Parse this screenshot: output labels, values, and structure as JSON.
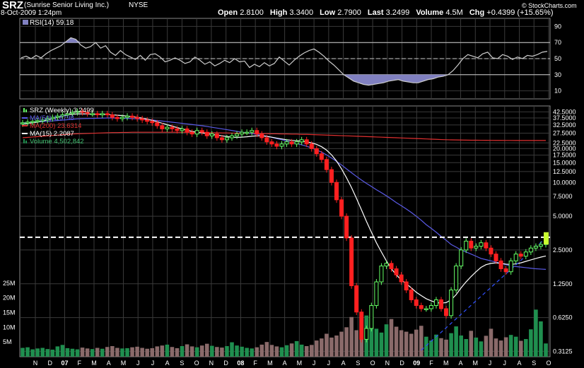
{
  "header": {
    "symbol": "SRZ",
    "company": "(Sunrise Senior Living Inc.)",
    "exchange": "NYSE",
    "datetime": "8-Oct-2009 1:24pm",
    "brand": "© StockCharts.com",
    "quote": {
      "open_label": "Open",
      "open": "2.8100",
      "high_label": "High",
      "high": "3.3400",
      "low_label": "Low",
      "low": "2.7900",
      "last_label": "Last",
      "last": "3.2499",
      "volume_label": "Volume",
      "volume": "4.5M",
      "chg_label": "Chg",
      "chg": "+0.4399 (+15.65%)"
    }
  },
  "colors": {
    "background": "#000000",
    "grid": "#3a3a3a",
    "up_candle": "#66ff66",
    "down_candle": "#ff2020",
    "ma50": "#5a5ae6",
    "ma200": "#e03030",
    "ma15": "#ffffff",
    "rsi_line": "#cccccc",
    "rsi_fill": "#8080c0",
    "volume_up": "#1f8f4f",
    "volume_down": "#8a6a6a",
    "resistance": "#ffffff",
    "trendline": "#3050ff"
  },
  "chart_data": [
    {
      "type": "line",
      "title": "RSI(14) 59.18",
      "legend": [
        {
          "name": "RSI(14)",
          "value": "59.18"
        }
      ],
      "yticks": [
        "90",
        "70",
        "50",
        "30",
        "10"
      ],
      "ylim": [
        0,
        100
      ],
      "reference_lines": [
        70,
        50,
        30
      ],
      "series": [
        {
          "name": "RSI(14)",
          "values": [
            51,
            53,
            50,
            54,
            51,
            56,
            60,
            63,
            66,
            71,
            76,
            74,
            67,
            63,
            65,
            70,
            63,
            66,
            58,
            54,
            60,
            55,
            52,
            49,
            54,
            48,
            55,
            56,
            52,
            46,
            48,
            51,
            48,
            44,
            46,
            52,
            48,
            43,
            46,
            41,
            44,
            48,
            45,
            50,
            46,
            47,
            39,
            43,
            40,
            45,
            41,
            44,
            52,
            47,
            42,
            48,
            53,
            57,
            60,
            62,
            58,
            53,
            47,
            42,
            36,
            30,
            26,
            22,
            20,
            18,
            17,
            18,
            19,
            20,
            22,
            23,
            24,
            22,
            21,
            20,
            20,
            22,
            24,
            25,
            27,
            28,
            30,
            35,
            42,
            50,
            55,
            53,
            51,
            56,
            58,
            51,
            50,
            55,
            53,
            49,
            52,
            50,
            54,
            53,
            55,
            58,
            59
          ]
        }
      ]
    },
    {
      "type": "line",
      "title": "SRZ (Weekly) 3.2499",
      "legend": [
        {
          "name": "SRZ (Weekly)",
          "value": "3.2499"
        },
        {
          "name": "MA(50)",
          "value": "1.6798"
        },
        {
          "name": "MA(200)",
          "value": "23.6314"
        },
        {
          "name": "MA(15)",
          "value": "2.2087"
        },
        {
          "name": "Volume",
          "value": "4,502,842"
        }
      ],
      "yscale": "log",
      "ylim": [
        0.28,
        48
      ],
      "yticks": [
        "42.5000",
        "37.5000",
        "32.5000",
        "27.5000",
        "22.5000",
        "20.0000",
        "17.5000",
        "15.0000",
        "12.5000",
        "10.0000",
        "7.5000",
        "5.0000",
        "2.5000",
        "1.2500",
        "0.6250",
        "0.3125"
      ],
      "ytick_values": [
        42.5,
        37.5,
        32.5,
        27.5,
        22.5,
        20,
        17.5,
        15,
        12.5,
        10,
        7.5,
        5,
        2.5,
        1.25,
        0.625,
        0.3125
      ],
      "xticks": [
        "N",
        "D",
        "07",
        "F",
        "M",
        "A",
        "M",
        "J",
        "J",
        "A",
        "S",
        "O",
        "N",
        "D",
        "08",
        "F",
        "M",
        "A",
        "M",
        "J",
        "J",
        "A",
        "S",
        "O",
        "N",
        "D",
        "09",
        "F",
        "M",
        "A",
        "M",
        "J",
        "J",
        "A",
        "S",
        "O"
      ],
      "resistance_level": 3.25,
      "series": [
        {
          "name": "SRZ (Weekly)",
          "values": [
            34,
            34.5,
            35,
            35.5,
            36,
            37,
            38,
            39,
            40,
            41,
            42,
            43,
            42,
            41,
            41,
            40,
            41,
            40,
            38,
            37,
            38,
            39,
            38,
            37,
            36,
            35,
            34,
            32,
            30,
            31,
            30,
            29,
            30,
            28,
            27,
            29,
            28,
            26,
            27,
            25,
            24,
            25,
            26,
            27,
            28,
            28,
            29,
            27,
            25,
            23,
            22,
            21,
            22,
            23,
            22,
            23,
            24,
            22,
            20,
            18,
            16,
            13,
            10,
            7,
            5,
            3.2,
            1.2,
            0.7,
            0.4,
            0.5,
            0.8,
            1.3,
            1.8,
            1.9,
            1.7,
            1.5,
            1.3,
            1.1,
            0.9,
            0.8,
            0.75,
            0.75,
            0.8,
            0.9,
            0.75,
            0.65,
            1.1,
            1.8,
            2.5,
            3,
            2.6,
            2.7,
            2.9,
            2.6,
            2.3,
            2,
            1.7,
            1.6,
            2,
            2.3,
            2.2,
            2.4,
            2.6,
            2.7,
            2.8,
            3.2
          ]
        },
        {
          "name": "MA(50)",
          "values": [
            34,
            34.2,
            34.4,
            34.6,
            34.8,
            35,
            35.3,
            35.6,
            35.9,
            36.2,
            36.5,
            36.8,
            37,
            37.1,
            37.2,
            37.3,
            37.4,
            37.5,
            37.5,
            37.4,
            37.3,
            37.2,
            37,
            36.8,
            36.6,
            36.3,
            36,
            35.6,
            35.2,
            34.8,
            34.4,
            34,
            33.6,
            33.2,
            32.8,
            32.4,
            32,
            31.5,
            31,
            30.5,
            30,
            29.5,
            29,
            28.5,
            28,
            27.6,
            27.2,
            26.8,
            26.3,
            25.8,
            25.2,
            24.6,
            24,
            23.4,
            22.8,
            22.2,
            21.6,
            21,
            20.3,
            19.5,
            18.6,
            17.6,
            16.5,
            15.4,
            14.3,
            13.2,
            12.2,
            11.3,
            10.5,
            9.8,
            9.2,
            8.6,
            8.1,
            7.6,
            7.1,
            6.6,
            6.2,
            5.8,
            5.4,
            5,
            4.6,
            4.2,
            3.9,
            3.6,
            3.3,
            3.05,
            2.8,
            2.65,
            2.5,
            2.4,
            2.3,
            2.2,
            2.1,
            2.05,
            2,
            1.95,
            1.9,
            1.85,
            1.8,
            1.78,
            1.76,
            1.74,
            1.72,
            1.7,
            1.69,
            1.68
          ]
        },
        {
          "name": "MA(200)",
          "values": [
            25,
            25.2,
            25.4,
            25.6,
            25.8,
            26,
            26.2,
            26.4,
            26.6,
            26.8,
            27,
            27.1,
            27.2,
            27.3,
            27.4,
            27.5,
            27.6,
            27.7,
            27.8,
            27.8,
            27.9,
            27.9,
            28,
            28,
            28,
            28,
            28,
            28,
            28,
            28,
            28,
            28,
            28,
            28,
            27.9,
            27.9,
            27.8,
            27.8,
            27.7,
            27.7,
            27.6,
            27.6,
            27.5,
            27.5,
            27.4,
            27.4,
            27.3,
            27.3,
            27.2,
            27.2,
            27.1,
            27.1,
            27,
            27,
            26.9,
            26.9,
            26.8,
            26.8,
            26.7,
            26.6,
            26.5,
            26.4,
            26.3,
            26.2,
            26.1,
            26,
            25.9,
            25.8,
            25.7,
            25.6,
            25.5,
            25.4,
            25.3,
            25.2,
            25.1,
            25,
            24.9,
            24.8,
            24.7,
            24.6,
            24.5,
            24.4,
            24.3,
            24.2,
            24.1,
            24,
            23.95,
            23.9,
            23.85,
            23.8,
            23.78,
            23.76,
            23.74,
            23.72,
            23.7,
            23.69,
            23.68,
            23.67,
            23.66,
            23.65,
            23.645,
            23.64,
            23.638,
            23.636,
            23.634,
            23.6314
          ]
        },
        {
          "name": "MA(15)",
          "values": [
            33,
            33.5,
            34,
            34.5,
            35.2,
            36,
            37,
            38,
            39,
            40,
            40.5,
            40.8,
            40.8,
            40.7,
            40.6,
            40.5,
            40.4,
            40.2,
            40,
            39.7,
            39.4,
            39,
            38.6,
            38,
            37.4,
            36.6,
            35.7,
            34.7,
            33.7,
            32.7,
            31.7,
            30.8,
            30,
            29.2,
            28.5,
            28,
            27.6,
            27.2,
            26.8,
            26.4,
            26,
            25.6,
            25.3,
            25.2,
            25.3,
            25.5,
            25.8,
            26,
            26,
            25.7,
            25.3,
            24.8,
            24.4,
            24,
            23.7,
            23.5,
            23.3,
            23,
            22.5,
            21.8,
            20.8,
            19.4,
            17.6,
            15.5,
            13.2,
            11,
            9,
            7.2,
            5.7,
            4.5,
            3.6,
            2.9,
            2.4,
            2,
            1.7,
            1.5,
            1.35,
            1.25,
            1.15,
            1.05,
            0.98,
            0.92,
            0.88,
            0.85,
            0.84,
            0.85,
            0.9,
            1,
            1.15,
            1.3,
            1.45,
            1.6,
            1.75,
            1.85,
            1.9,
            1.92,
            1.9,
            1.87,
            1.86,
            1.88,
            1.92,
            1.98,
            2.04,
            2.1,
            2.16,
            2.2087
          ]
        },
        {
          "name": "Volume",
          "values": [
            3,
            3.2,
            2.5,
            2.8,
            3,
            2.6,
            2.4,
            3.5,
            4,
            2.9,
            2.7,
            2.5,
            3.1,
            2.8,
            2.6,
            3,
            2.7,
            3.3,
            3.6,
            3,
            2.8,
            2.9,
            3.2,
            3.4,
            3,
            2.7,
            2.9,
            3.5,
            3.8,
            4.1,
            3.3,
            2.9,
            3.6,
            4.2,
            3.5,
            3.2,
            3.8,
            4.4,
            3.7,
            3.3,
            3.1,
            3.6,
            4.9,
            3.8,
            3.4,
            3,
            2.8,
            3.2,
            4.1,
            5,
            4,
            3.5,
            3.2,
            3.9,
            4.5,
            5.3,
            4.1,
            3.6,
            4,
            5.5,
            6.2,
            7.8,
            6.5,
            7.2,
            8.5,
            10,
            13.5,
            9,
            11,
            14,
            12.5,
            9.5,
            8.2,
            11,
            12.8,
            10.2,
            9,
            8.5,
            7.8,
            9.2,
            10.5,
            6.8,
            5.5,
            7.5,
            6.3,
            5.8,
            8,
            10.3,
            7.2,
            6,
            8.8,
            6.5,
            5.2,
            7.1,
            9.5,
            6.2,
            5.5,
            6.6,
            7.4,
            6.8,
            5.4,
            6,
            9.3,
            16,
            12,
            4.5
          ]
        }
      ]
    },
    {
      "type": "bar",
      "title": "Volume",
      "yticks": [
        "25M",
        "20M",
        "15M",
        "10M",
        "5M"
      ],
      "ylim": [
        0,
        30
      ]
    }
  ]
}
